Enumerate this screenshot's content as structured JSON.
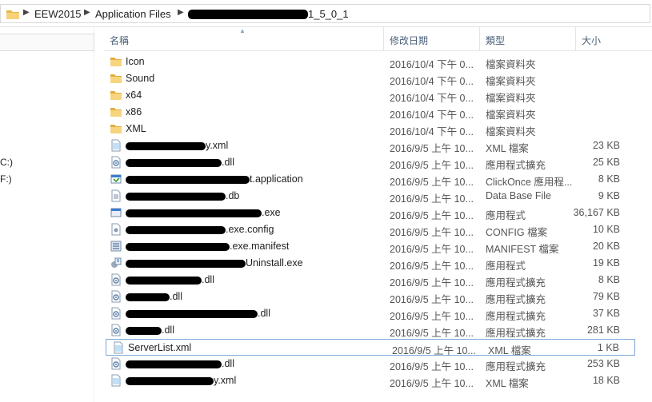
{
  "address_bar": {
    "crumbs": [
      "EEW2015",
      "Application Files",
      "1_5_0_1"
    ]
  },
  "nav_pane": {
    "drives": [
      "C:)",
      "F:)"
    ]
  },
  "columns": {
    "name": "名稱",
    "date": "修改日期",
    "type": "類型",
    "size": "大小"
  },
  "files": [
    {
      "icon": "folder-icon",
      "name": "Icon",
      "date": "2016/10/4 下午 0...",
      "type": "檔案資料夾",
      "size": ""
    },
    {
      "icon": "folder-icon",
      "name": "Sound",
      "date": "2016/10/4 下午 0...",
      "type": "檔案資料夾",
      "size": ""
    },
    {
      "icon": "folder-icon",
      "name": "x64",
      "date": "2016/10/4 下午 0...",
      "type": "檔案資料夾",
      "size": ""
    },
    {
      "icon": "folder-icon",
      "name": "x86",
      "date": "2016/10/4 下午 0...",
      "type": "檔案資料夾",
      "size": ""
    },
    {
      "icon": "folder-icon",
      "name": "XML",
      "date": "2016/10/4 下午 0...",
      "type": "檔案資料夾",
      "size": ""
    },
    {
      "icon": "xml-file-icon",
      "name": "y.xml",
      "date": "2016/9/5 上午 10...",
      "type": "XML 檔案",
      "size": "23 KB"
    },
    {
      "icon": "dll-file-icon",
      "name": ".dll",
      "date": "2016/9/5 上午 10...",
      "type": "應用程式擴充",
      "size": "25 KB"
    },
    {
      "icon": "application-manifest-icon",
      "name": "t.application",
      "date": "2016/9/5 上午 10...",
      "type": "ClickOnce 應用程...",
      "size": "8 KB"
    },
    {
      "icon": "db-file-icon",
      "name": ".db",
      "date": "2016/9/5 上午 10...",
      "type": "Data Base File",
      "size": "9 KB"
    },
    {
      "icon": "exe-file-icon",
      "name": ".exe",
      "date": "2016/9/5 上午 10...",
      "type": "應用程式",
      "size": "36,167 KB"
    },
    {
      "icon": "config-file-icon",
      "name": ".exe.config",
      "date": "2016/9/5 上午 10...",
      "type": "CONFIG 檔案",
      "size": "10 KB"
    },
    {
      "icon": "manifest-file-icon",
      "name": ".exe.manifest",
      "date": "2016/9/5 上午 10...",
      "type": "MANIFEST 檔案",
      "size": "20 KB"
    },
    {
      "icon": "uninstall-exe-icon",
      "name": "Uninstall.exe",
      "date": "2016/9/5 上午 10...",
      "type": "應用程式",
      "size": "19 KB"
    },
    {
      "icon": "dll-file-icon",
      "name": ".dll",
      "date": "2016/9/5 上午 10...",
      "type": "應用程式擴充",
      "size": "8 KB"
    },
    {
      "icon": "dll-file-icon",
      "name": ".dll",
      "date": "2016/9/5 上午 10...",
      "type": "應用程式擴充",
      "size": "79 KB"
    },
    {
      "icon": "dll-file-icon",
      "name": ".dll",
      "date": "2016/9/5 上午 10...",
      "type": "應用程式擴充",
      "size": "37 KB"
    },
    {
      "icon": "dll-file-icon",
      "name": ".dll",
      "date": "2016/9/5 上午 10...",
      "type": "應用程式擴充",
      "size": "281 KB"
    },
    {
      "icon": "xml-file-icon",
      "name": "ServerList.xml",
      "date": "2016/9/5 上午 10...",
      "type": "XML 檔案",
      "size": "1 KB"
    },
    {
      "icon": "dll-file-icon",
      "name": ".dll",
      "date": "2016/9/5 上午 10...",
      "type": "應用程式擴充",
      "size": "253 KB"
    },
    {
      "icon": "xml-file-icon",
      "name": "y.xml",
      "date": "2016/9/5 上午 10...",
      "type": "XML 檔案",
      "size": "18 KB"
    }
  ]
}
